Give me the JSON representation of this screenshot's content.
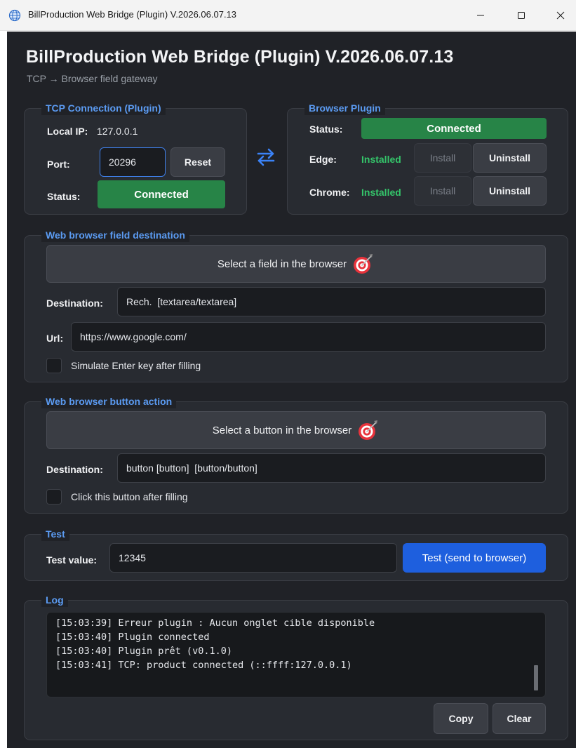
{
  "window": {
    "title": "BillProduction Web Bridge (Plugin) V.2026.06.07.13"
  },
  "header": {
    "title": "BillProduction Web Bridge (Plugin) V.2026.06.07.13",
    "subtitle": "TCP → Browser field gateway"
  },
  "tcp": {
    "group_label": "TCP Connection (Plugin)",
    "local_ip_label": "Local IP:",
    "local_ip_value": "127.0.0.1",
    "port_label": "Port:",
    "port_value": "20296",
    "reset_label": "Reset",
    "status_label": "Status:",
    "status_value": "Connected"
  },
  "plugin": {
    "group_label": "Browser Plugin",
    "status_label": "Status:",
    "status_value": "Connected",
    "edge_label": "Edge:",
    "edge_state": "Installed",
    "chrome_label": "Chrome:",
    "chrome_state": "Installed",
    "install_label": "Install",
    "uninstall_label": "Uninstall"
  },
  "field_dest": {
    "group_label": "Web browser field destination",
    "select_label": "Select a field in the browser",
    "destination_label": "Destination:",
    "destination_value": "Rech.  [textarea/textarea]",
    "url_label": "Url:",
    "url_value": "https://www.google.com/",
    "enter_checkbox_label": "Simulate Enter key after filling",
    "enter_checked": false
  },
  "button_action": {
    "group_label": "Web browser button action",
    "select_label": "Select a button in the browser",
    "destination_label": "Destination:",
    "destination_value": "button [button]  [button/button]",
    "click_checkbox_label": "Click this button after filling",
    "click_checked": false
  },
  "test": {
    "group_label": "Test",
    "value_label": "Test value:",
    "value": "12345",
    "send_label": "Test (send to browser)"
  },
  "log": {
    "group_label": "Log",
    "lines": [
      "[15:03:39] Erreur plugin : Aucun onglet cible disponible",
      "[15:03:40] Plugin connected",
      "[15:03:40] Plugin prêt (v0.1.0)",
      "[15:03:41] TCP: product connected (::ffff:127.0.0.1)"
    ],
    "copy_label": "Copy",
    "clear_label": "Clear"
  },
  "colors": {
    "accent": "#5b9bf2",
    "connected": "#278447",
    "installed": "#34c46a",
    "primary_button": "#1e5fde",
    "background": "#202227"
  }
}
